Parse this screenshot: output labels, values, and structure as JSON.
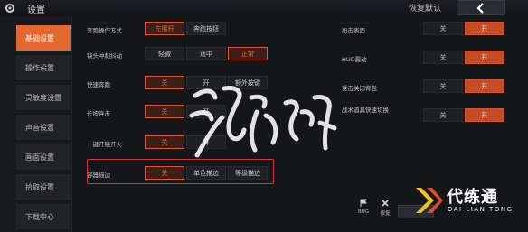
{
  "header": {
    "title": "设置",
    "restore_label": "恢复默认"
  },
  "sidebar": {
    "items": [
      {
        "label": "基础设置",
        "active": true
      },
      {
        "label": "操作设置",
        "active": false
      },
      {
        "label": "灵敏度设置",
        "active": false
      },
      {
        "label": "声音设置",
        "active": false
      },
      {
        "label": "画面设置",
        "active": false
      },
      {
        "label": "拾取设置",
        "active": false
      },
      {
        "label": "下载中心",
        "active": false
      }
    ]
  },
  "settings_left": [
    {
      "label": "奔跑操作方式",
      "options": [
        "左摇杆",
        "奔跑按钮"
      ],
      "selected": 0
    },
    {
      "label": "镜头冲刺抖动",
      "options": [
        "轻微",
        "适中",
        "正常"
      ],
      "selected": 2
    },
    {
      "label": "快速奔跑",
      "options": [
        "关",
        "开",
        "额外按键"
      ],
      "selected": 0
    },
    {
      "label": "长按连击",
      "options": [
        "关",
        "开"
      ],
      "selected": 0
    },
    {
      "label": "一键开镜开火",
      "options": [
        "关",
        "开"
      ],
      "selected": 0
    },
    {
      "label": "容器描边",
      "options": [
        "关",
        "单色描边",
        "等级描边"
      ],
      "selected": 0,
      "highlighted": true
    }
  ],
  "settings_right": [
    {
      "label": "段击表面",
      "options": [
        "关",
        "开"
      ],
      "selected": 1
    },
    {
      "label": "HUD震动",
      "options": [
        "关",
        "开"
      ],
      "selected": 1
    },
    {
      "label": "受击关闭背包",
      "options": [
        "关",
        "开"
      ],
      "selected": 1
    },
    {
      "label": "战术道具快速切换",
      "options": [
        "关",
        "开"
      ],
      "selected": 1
    }
  ],
  "bottom": {
    "bug_label": "BUG",
    "repair_label": "修复"
  },
  "logo": {
    "text": "代练通",
    "sub": "DAI LIAN TONG"
  },
  "colors": {
    "accent": "#e46930",
    "highlight_box": "#d2372d"
  }
}
